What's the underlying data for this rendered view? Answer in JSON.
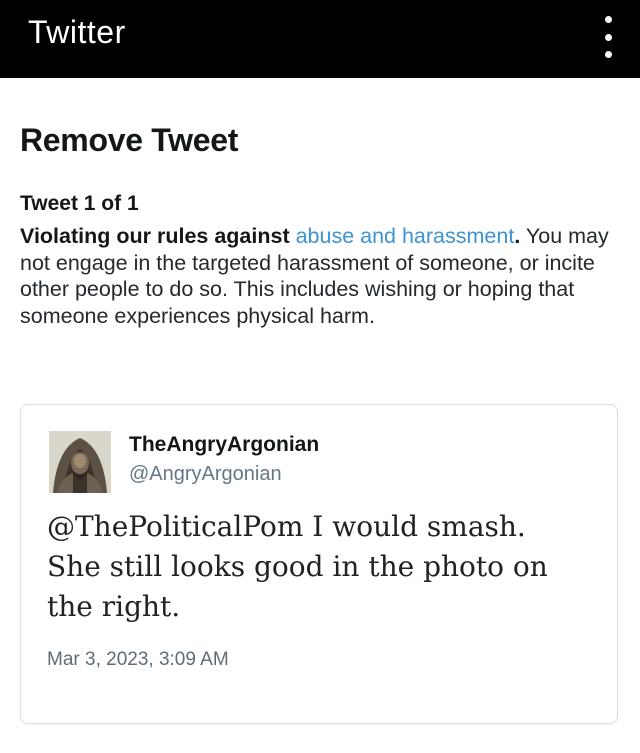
{
  "appbar": {
    "title": "Twitter",
    "menu_icon": "more-vertical-icon"
  },
  "page": {
    "title": "Remove Tweet",
    "counter": "Tweet 1 of 1"
  },
  "violation": {
    "heading_prefix": "Violating our rules against ",
    "link_text": "abuse and harassment",
    "heading_suffix": ".",
    "description": "You may not engage in the targeted harassment of someone, or incite other people to do so. This includes wishing or hoping that someone experiences physical harm."
  },
  "tweet": {
    "display_name": "TheAngryArgonian",
    "handle": "@AngryArgonian",
    "text": "@ThePoliticalPom I would smash. She still looks good in the photo on the right.",
    "timestamp": "Mar 3, 2023, 3:09 AM",
    "avatar_icon": "hooded-figure-avatar"
  },
  "colors": {
    "appbar_bg": "#000000",
    "link": "#3c93d6",
    "muted": "#657786"
  }
}
